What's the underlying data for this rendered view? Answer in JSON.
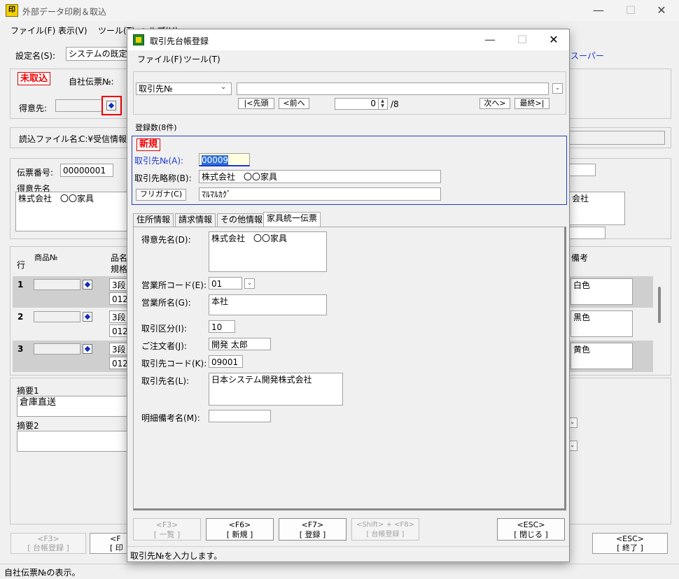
{
  "main": {
    "title": "外部データ印刷＆取込",
    "icon_text": "印",
    "controls": {
      "minimize": "—",
      "maximize": "☐",
      "close": "✕"
    },
    "menu": [
      "ファイル(F)",
      "表示(V)",
      "ツール(T)",
      "ヘルプ(H)"
    ],
    "settings_label": "設定名(S):",
    "settings_value": "システムの既定値",
    "super_link": "スーパー",
    "status_flag": "未取込",
    "company_slip_label": "自社伝票№:",
    "customer_label": "得意先:",
    "read_file_label": "読込ファイル名:",
    "read_file_value": "C:¥受信情報¥",
    "slip_number_label": "伝票番号:",
    "slip_number_value": "00000001",
    "customer_name_label": "得意先名",
    "customer_name_value": "株式会社　〇〇家具",
    "right_customer_value": "会社",
    "grid_headers": {
      "row": "行",
      "product_no": "商品№",
      "product_name": "品名",
      "spec": "規格",
      "remarks": "備考"
    },
    "rows": [
      {
        "no": "1",
        "name": "3段",
        "code": "0123",
        "remarks": "白色"
      },
      {
        "no": "2",
        "name": "3段",
        "code": "0123",
        "remarks": "黒色"
      },
      {
        "no": "3",
        "name": "3段",
        "code": "0123",
        "remarks": "黄色"
      }
    ],
    "summary1_label": "摘要1",
    "summary1_value": "倉庫直送",
    "summary2_label": "摘要2",
    "bottom_buttons": {
      "f3": "<F3>",
      "f3_label": "[ 台帳登録 ]",
      "f_print": "<F",
      "f_print_label": "[ 印",
      "esc": "<ESC>",
      "esc_label": "[ 終了 ]"
    },
    "status_text": "自社伝票№の表示。"
  },
  "dialog": {
    "title": "取引先台帳登録",
    "controls": {
      "minimize": "—",
      "maximize": "☐",
      "close": "✕"
    },
    "menu": [
      "ファイル(F)",
      "ツール(T)"
    ],
    "search_field": "取引先№",
    "nav": {
      "first": "|<先頭",
      "prev": "<前へ",
      "current": "0",
      "total": "/8",
      "next": "次へ>",
      "last": "最終>|"
    },
    "record_count": "登録数(8件)",
    "new_badge": "新規",
    "partner_no_label": "取引先№(A):",
    "partner_no_value": "00009",
    "short_name_label": "取引先略称(B):",
    "short_name_value": "株式会社　〇〇家具",
    "furigana_button": "フリガナ(C)",
    "furigana_value": "ﾏﾙﾏﾙｶｸﾞ",
    "tabs": [
      "住所情報",
      "請求情報",
      "その他情報",
      "家具統一伝票"
    ],
    "form": {
      "customer_name_label": "得意先名(D):",
      "customer_name_value": "株式会社　〇〇家具",
      "office_code_label": "営業所コード(E):",
      "office_code_value": "01",
      "office_name_label": "営業所名(G):",
      "office_name_value": "本社",
      "trade_class_label": "取引区分(I):",
      "trade_class_value": "10",
      "orderer_label": "ご注文者(J):",
      "orderer_value": "開発 太郎",
      "partner_code_label": "取引先コード(K):",
      "partner_code_value": "09001",
      "partner_name_label": "取引先名(L):",
      "partner_name_value": "日本システム開発株式会社",
      "detail_remarks_label": "明細備考名(M):",
      "detail_remarks_value": ""
    },
    "fkeys": [
      {
        "key": "<F3>",
        "label": "[ 一覧 ]"
      },
      {
        "key": "<F6>",
        "label": "[ 新規 ]"
      },
      {
        "key": "<F7>",
        "label": "[ 登録 ]"
      },
      {
        "key": "<Shift> + <F8>",
        "label": "[ 台帳登録 ]"
      },
      {
        "key": "<ESC>",
        "label": "[ 閉じる ]"
      }
    ],
    "status_text": "取引先№を入力します。"
  }
}
